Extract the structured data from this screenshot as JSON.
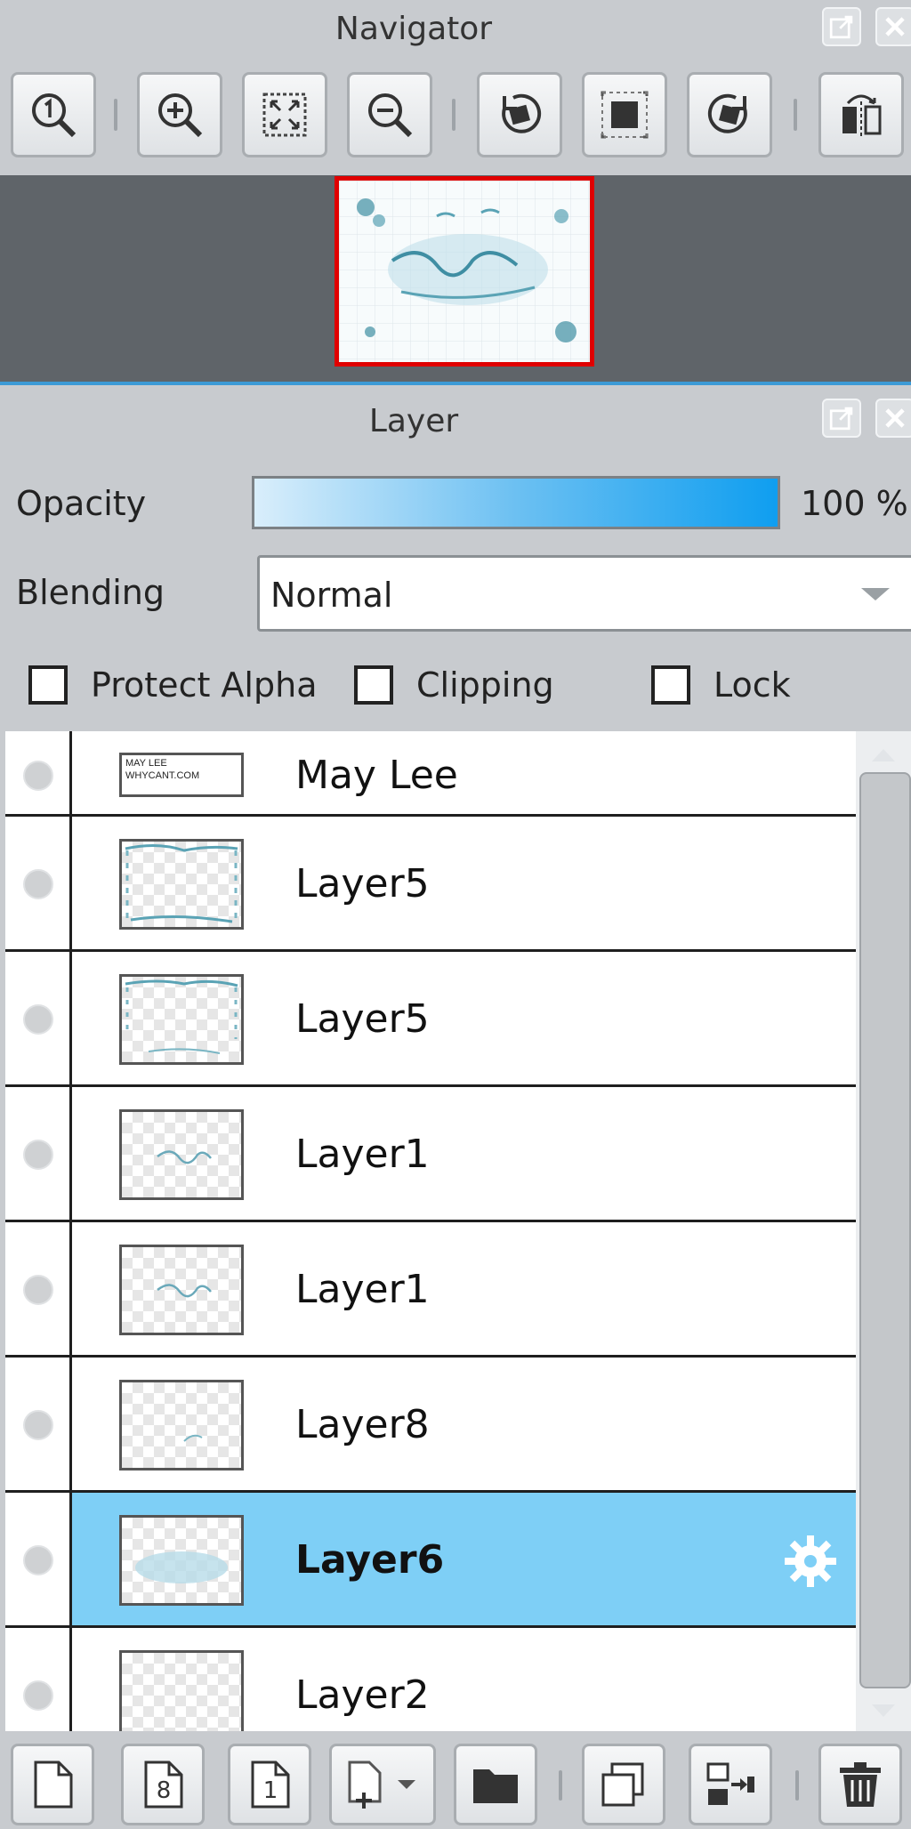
{
  "navigator": {
    "title": "Navigator"
  },
  "layer_panel": {
    "title": "Layer",
    "opacity_label": "Opacity",
    "opacity_value": "100 %",
    "opacity_fraction": 1.0,
    "blending_label": "Blending",
    "blending_value": "Normal",
    "protect_alpha_label": "Protect Alpha",
    "clipping_label": "Clipping",
    "lock_label": "Lock",
    "layers": [
      {
        "name": "May Lee",
        "selected": false,
        "thumb_text": "MAY LEE WHYCANT.COM"
      },
      {
        "name": "Layer5",
        "selected": false
      },
      {
        "name": "Layer5",
        "selected": false
      },
      {
        "name": "Layer1",
        "selected": false
      },
      {
        "name": "Layer1",
        "selected": false
      },
      {
        "name": "Layer8",
        "selected": false
      },
      {
        "name": "Layer6",
        "selected": true
      },
      {
        "name": "Layer2",
        "selected": false
      }
    ]
  },
  "colors": {
    "accent": "#3c9ad6",
    "selected_row": "#7ecff6",
    "nav_frame": "#e00000"
  }
}
